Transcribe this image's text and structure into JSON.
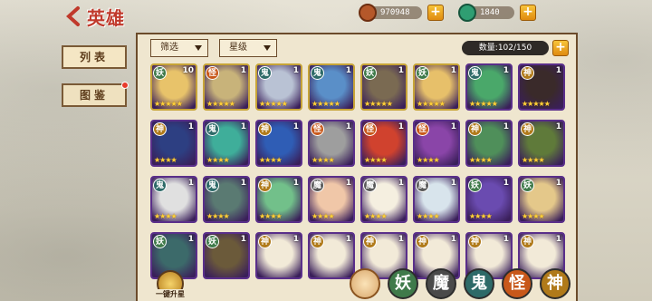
{
  "header": {
    "title": "英雄"
  },
  "resources": {
    "coins": "970948",
    "jade": "1840",
    "coin_color": "#b5582a",
    "jade_color": "#2f9e72"
  },
  "tabs": [
    {
      "label": "列表",
      "icon": "list-tab"
    },
    {
      "label": "图鉴",
      "icon": "codex-tab"
    }
  ],
  "filters": {
    "filter_label": "筛选",
    "star_label": "星级",
    "count": "数量:102/150"
  },
  "colors": {
    "purple_frame": "#5a2f8a",
    "gold_frame": "#c7a437"
  },
  "heroes": [
    {
      "faction": "妖",
      "level": "10",
      "stars": "★★★★★",
      "frame": "gold",
      "bg": "#e8c36a"
    },
    {
      "faction": "怪",
      "level": "1",
      "stars": "★★★★★",
      "frame": "gold",
      "bg": "#c8b37a"
    },
    {
      "faction": "鬼",
      "level": "1",
      "stars": "★★★★★",
      "frame": "gold",
      "bg": "#b9c2d4"
    },
    {
      "faction": "鬼",
      "level": "1",
      "stars": "★★★★★",
      "frame": "gold",
      "bg": "#5a8fc8"
    },
    {
      "faction": "妖",
      "level": "1",
      "stars": "★★★★★",
      "frame": "gold",
      "bg": "#7a6a52"
    },
    {
      "faction": "妖",
      "level": "1",
      "stars": "★★★★★",
      "frame": "gold",
      "bg": "#e7c06a"
    },
    {
      "faction": "鬼",
      "level": "1",
      "stars": "★★★★★",
      "frame": "purple",
      "bg": "#4aa86a"
    },
    {
      "faction": "神",
      "level": "1",
      "stars": "★★★★★",
      "frame": "purple",
      "bg": "#3a2a2a"
    },
    {
      "faction": "神",
      "level": "1",
      "stars": "★★★★",
      "frame": "purple",
      "bg": "#2d3f82"
    },
    {
      "faction": "鬼",
      "level": "1",
      "stars": "★★★★",
      "frame": "purple",
      "bg": "#3fae9a"
    },
    {
      "faction": "神",
      "level": "1",
      "stars": "★★★★",
      "frame": "purple",
      "bg": "#2f5db5"
    },
    {
      "faction": "怪",
      "level": "1",
      "stars": "★★★★",
      "frame": "purple",
      "bg": "#9e9e9e"
    },
    {
      "faction": "怪",
      "level": "1",
      "stars": "★★★★",
      "frame": "purple",
      "bg": "#d0422e"
    },
    {
      "faction": "怪",
      "level": "1",
      "stars": "★★★★",
      "frame": "purple",
      "bg": "#8a45a8"
    },
    {
      "faction": "神",
      "level": "1",
      "stars": "★★★★",
      "frame": "purple",
      "bg": "#4f8f5a"
    },
    {
      "faction": "神",
      "level": "1",
      "stars": "★★★★",
      "frame": "purple",
      "bg": "#5f7a3a"
    },
    {
      "faction": "鬼",
      "level": "1",
      "stars": "★★★★",
      "frame": "purple",
      "bg": "#e0e0e0"
    },
    {
      "faction": "鬼",
      "level": "1",
      "stars": "★★★★",
      "frame": "purple",
      "bg": "#5a7a72"
    },
    {
      "faction": "神",
      "level": "1",
      "stars": "★★★★",
      "frame": "purple",
      "bg": "#72c08a"
    },
    {
      "faction": "魔",
      "level": "1",
      "stars": "★★★★",
      "frame": "purple",
      "bg": "#f0c7a8"
    },
    {
      "faction": "魔",
      "level": "1",
      "stars": "★★★★",
      "frame": "purple",
      "bg": "#f5efe0"
    },
    {
      "faction": "魔",
      "level": "1",
      "stars": "★★★★",
      "frame": "purple",
      "bg": "#d8e4ec"
    },
    {
      "faction": "妖",
      "level": "1",
      "stars": "★★★★",
      "frame": "purple",
      "bg": "#6a4bb0"
    },
    {
      "faction": "妖",
      "level": "1",
      "stars": "★★★★",
      "frame": "purple",
      "bg": "#e4c88a"
    },
    {
      "faction": "妖",
      "level": "1",
      "stars": "",
      "frame": "purple",
      "bg": "#3c6a6a"
    },
    {
      "faction": "妖",
      "level": "1",
      "stars": "",
      "frame": "purple",
      "bg": "#6b5a3a"
    },
    {
      "faction": "神",
      "level": "1",
      "stars": "",
      "frame": "purple",
      "bg": "#f2ead8"
    },
    {
      "faction": "神",
      "level": "1",
      "stars": "",
      "frame": "purple",
      "bg": "#f2ead8"
    },
    {
      "faction": "神",
      "level": "1",
      "stars": "",
      "frame": "purple",
      "bg": "#f2ead8"
    },
    {
      "faction": "神",
      "level": "1",
      "stars": "",
      "frame": "purple",
      "bg": "#f2ead8"
    },
    {
      "faction": "神",
      "level": "1",
      "stars": "",
      "frame": "purple",
      "bg": "#f2ead8"
    },
    {
      "faction": "神",
      "level": "1",
      "stars": "",
      "frame": "purple",
      "bg": "#f2ead8"
    }
  ],
  "faction_colors": {
    "妖": "#3f7a4a",
    "怪": "#c8581a",
    "鬼": "#2d6a68",
    "神": "#b07a1a",
    "魔": "#5a5a5a"
  },
  "bottom": {
    "upgrade_label": "一键升星",
    "faction_filters": [
      {
        "label": "",
        "color": "#d8a66a",
        "icon": "all-factions-icon"
      },
      {
        "label": "妖",
        "color": "#3f7a4a"
      },
      {
        "label": "魔",
        "color": "#4a4a4a"
      },
      {
        "label": "鬼",
        "color": "#2d6a68"
      },
      {
        "label": "怪",
        "color": "#c8581a"
      },
      {
        "label": "神",
        "color": "#b07a1a"
      }
    ]
  }
}
